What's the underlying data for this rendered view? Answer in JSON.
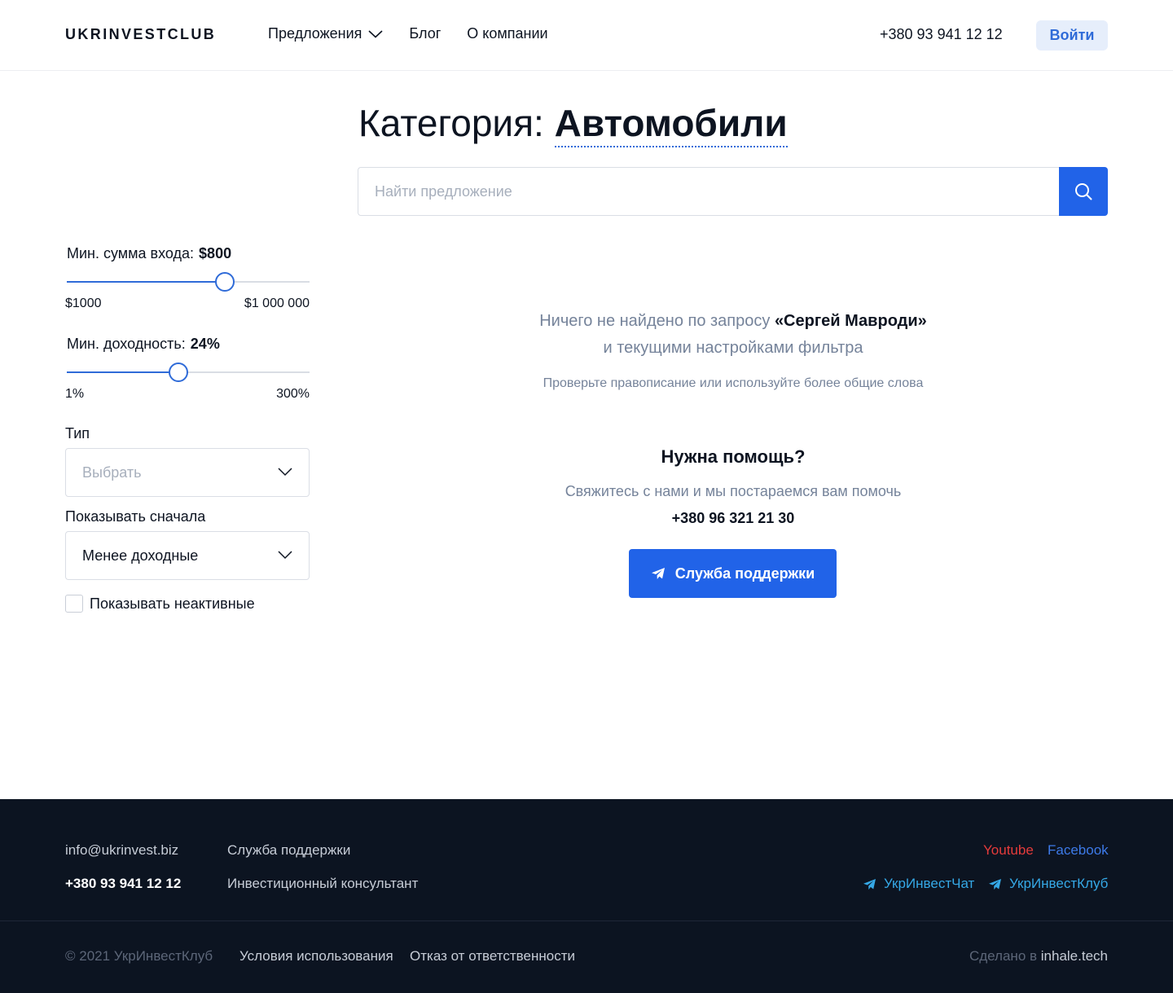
{
  "header": {
    "logo": "UKRINVESTCLUB",
    "nav": [
      {
        "label": "Предложения",
        "has_dropdown": true
      },
      {
        "label": "Блог"
      },
      {
        "label": "О компании"
      }
    ],
    "phone": "+380 93 941 12 12",
    "login_label": "Войти"
  },
  "title": {
    "prefix": "Категория:",
    "value": "Автомобили"
  },
  "search": {
    "placeholder": "Найти предложение",
    "value": ""
  },
  "filters": {
    "min_entry": {
      "label": "Мин. сумма входа:",
      "value_label": "$800",
      "min_label": "$1000",
      "max_label": "$1 000 000",
      "position": 0.65
    },
    "min_yield": {
      "label": "Мин. доходность:",
      "value_label": "24%",
      "min_label": "1%",
      "max_label": "300%",
      "position": 0.46
    },
    "type": {
      "label": "Тип",
      "placeholder": "Выбрать"
    },
    "sort": {
      "label": "Показывать сначала",
      "value": "Менее доходные"
    },
    "show_inactive": {
      "label": "Показывать неактивные",
      "checked": false
    }
  },
  "empty_state": {
    "line1_prefix": "Ничего не найдено по запросу ",
    "query": "«Сергей Мавроди»",
    "line2": "и текущими настройками фильтра",
    "hint": "Проверьте правописание или используйте более общие слова"
  },
  "help": {
    "title": "Нужна помощь?",
    "text": "Свяжитесь с нами и мы постараемся вам помочь",
    "phone": "+380 96 321 21 30",
    "button_label": "Служба поддержки"
  },
  "footer": {
    "email": "info@ukrinvest.biz",
    "phone": "+380 93 941 12 12",
    "link_support": "Служба поддержки",
    "link_consultant": "Инвестиционный консультант",
    "youtube": "Youtube",
    "facebook": "Facebook",
    "tg_chat": "УкрИнвестЧат",
    "tg_club": "УкрИнвестКлуб",
    "copyright": "© 2021 УкрИнвестКлуб",
    "terms": "Условия использования",
    "disclaimer": "Отказ от ответственности",
    "made_by_prefix": "Сделано в",
    "made_by": "inhale.tech"
  },
  "colors": {
    "accent": "#2163e8",
    "footer_bg": "#0c1421",
    "youtube": "#e53b3b",
    "facebook": "#3d7ae8",
    "telegram": "#35a8e6"
  },
  "icons": [
    "chevron-down-icon",
    "search-icon",
    "telegram-icon"
  ]
}
